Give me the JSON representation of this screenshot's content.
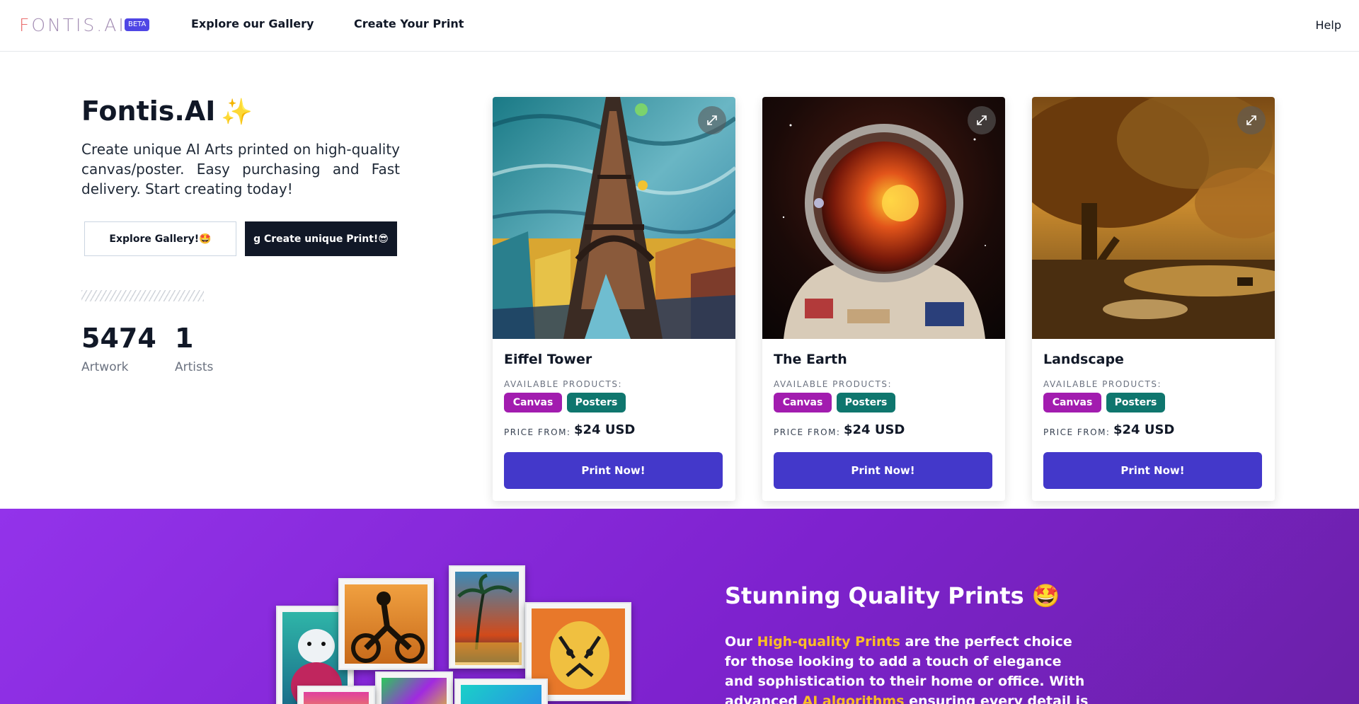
{
  "header": {
    "logo_first": "F",
    "logo_rest": "ONTIS.AI",
    "beta_badge": "BETA",
    "nav": [
      "Explore our Gallery",
      "Create Your Print"
    ],
    "help": "Help"
  },
  "hero": {
    "title": "Fontis.AI",
    "title_icon": "✨",
    "description": "Create unique AI Arts printed on high-quality canvas/poster. Easy purchasing and Fast delivery. Start creating today!",
    "btn_explore": "Explore Gallery!🤩",
    "btn_create": "g Create unique Print!😎",
    "stats": [
      {
        "value": "5474",
        "label": "Artwork"
      },
      {
        "value": "1",
        "label": "Artists"
      }
    ]
  },
  "cards": [
    {
      "title": "Eiffel Tower",
      "image_icon": "eiffel-tower-painting",
      "available_label": "AVAILABLE PRODUCTS:",
      "tags": [
        "Canvas",
        "Posters"
      ],
      "price_label": "PRICE FROM:",
      "price": "$24 USD",
      "button": "Print Now!"
    },
    {
      "title": "The Earth",
      "image_icon": "astronaut-painting",
      "available_label": "AVAILABLE PRODUCTS:",
      "tags": [
        "Canvas",
        "Posters"
      ],
      "price_label": "PRICE FROM:",
      "price": "$24 USD",
      "button": "Print Now!"
    },
    {
      "title": "Landscape",
      "image_icon": "landscape-painting",
      "available_label": "AVAILABLE PRODUCTS:",
      "tags": [
        "Canvas",
        "Posters"
      ],
      "price_label": "PRICE FROM:",
      "price": "$24 USD",
      "button": "Print Now!"
    }
  ],
  "quality": {
    "title": "Stunning Quality Prints 🤩",
    "desc_1": "Our ",
    "desc_hl_1": "High-quality Prints",
    "desc_2": " are the perfect choice for those looking to add a touch of elegance and sophistication to their home or office. With advanced ",
    "desc_hl_2": "AI algorithms",
    "desc_3": " ensuring every detail is"
  },
  "colors": {
    "accent": "#4338ca",
    "canvas_tag": "#a21caf",
    "posters_tag": "#0f766e",
    "section_purple": "#7e22ce",
    "highlight": "#fbbf24"
  }
}
